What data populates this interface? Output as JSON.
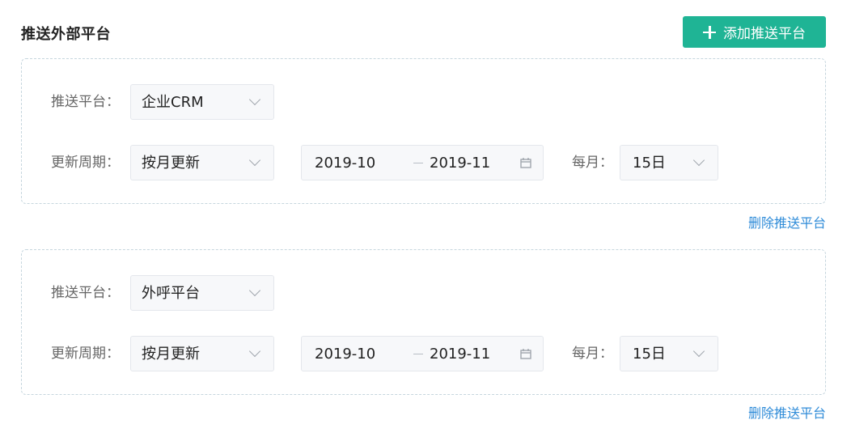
{
  "header": {
    "title": "推送外部平台",
    "add_button_label": "添加推送平台",
    "add_icon": "plus-icon"
  },
  "colors": {
    "accent": "#1fb495",
    "link": "#2e8bd8",
    "border_dashed": "#c6d6de"
  },
  "platforms": [
    {
      "platform_label": "推送平台：",
      "platform_value": "企业CRM",
      "cycle_label": "更新周期：",
      "cycle_value": "按月更新",
      "date_start": "2019-10",
      "date_end": "2019-11",
      "monthly_label": "每月：",
      "monthly_value": "15日",
      "delete_label": "删除推送平台"
    },
    {
      "platform_label": "推送平台：",
      "platform_value": "外呼平台",
      "cycle_label": "更新周期：",
      "cycle_value": "按月更新",
      "date_start": "2019-10",
      "date_end": "2019-11",
      "monthly_label": "每月：",
      "monthly_value": "15日",
      "delete_label": "删除推送平台"
    }
  ]
}
